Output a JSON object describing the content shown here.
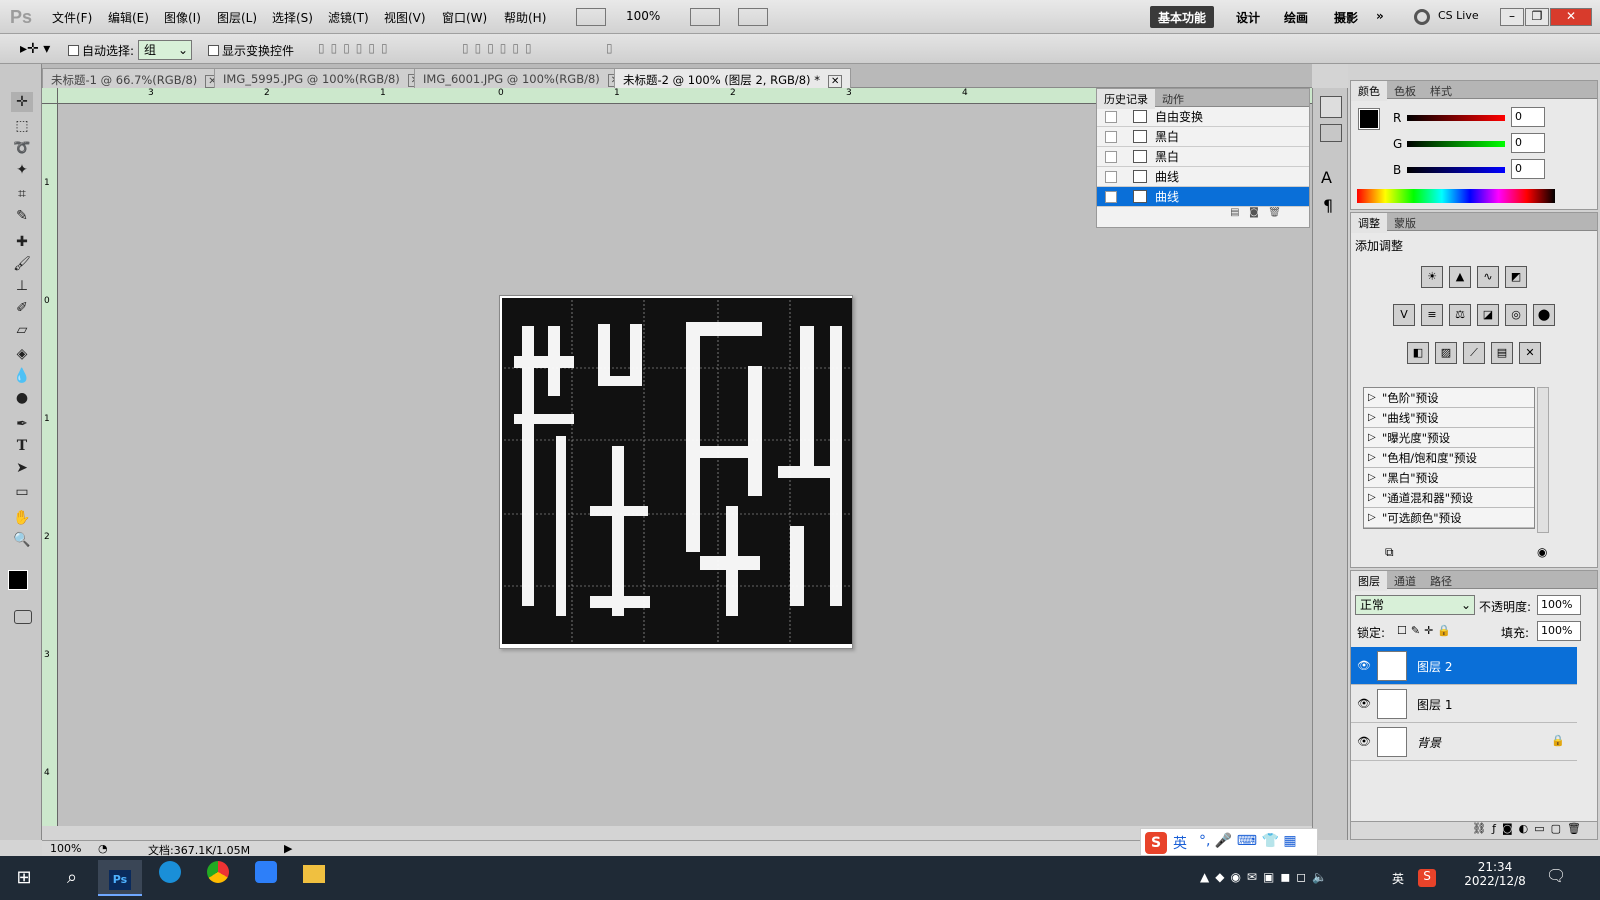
{
  "menubar": {
    "logo": "Ps",
    "items": [
      "文件(F)",
      "编辑(E)",
      "图像(I)",
      "图层(L)",
      "选择(S)",
      "滤镜(T)",
      "视图(V)",
      "窗口(W)",
      "帮助(H)"
    ],
    "zoom": "100%",
    "workspaces": [
      "基本功能",
      "设计",
      "绘画",
      "摄影"
    ],
    "active_workspace": "基本功能",
    "more": "»",
    "cs_live": "CS Live"
  },
  "options": {
    "auto_select_label": "自动选择:",
    "auto_select_value": "组",
    "show_transform_label": "显示变换控件"
  },
  "tabs": [
    {
      "label": "未标题-1 @ 66.7%(RGB/8)"
    },
    {
      "label": "IMG_5995.JPG @ 100%(RGB/8)"
    },
    {
      "label": "IMG_6001.JPG @ 100%(RGB/8)"
    },
    {
      "label": "未标题-2 @ 100% (图层 2, RGB/8) *"
    }
  ],
  "ruler_top": [
    "3",
    "2",
    "1",
    "0",
    "1",
    "2",
    "3",
    "4"
  ],
  "ruler_left": [
    "1",
    "0",
    "1",
    "2",
    "3",
    "4"
  ],
  "status": {
    "zoom": "100%",
    "doc": "文档:367.1K/1.05M"
  },
  "history": {
    "tabs": [
      "历史记录",
      "动作"
    ],
    "rows": [
      "自由变换",
      "黑白",
      "黑白",
      "曲线",
      "曲线"
    ]
  },
  "color_panel": {
    "tabs": [
      "颜色",
      "色板",
      "样式"
    ],
    "r_label": "R",
    "g_label": "G",
    "b_label": "B",
    "r": "0",
    "g": "0",
    "b": "0"
  },
  "adjust_panel": {
    "tabs": [
      "调整",
      "蒙版"
    ],
    "title": "添加调整",
    "presets": [
      "\"色阶\"预设",
      "\"曲线\"预设",
      "\"曝光度\"预设",
      "\"色相/饱和度\"预设",
      "\"黑白\"预设",
      "\"通道混和器\"预设",
      "\"可选颜色\"预设"
    ]
  },
  "layers_panel": {
    "tabs": [
      "图层",
      "通道",
      "路径"
    ],
    "blend": "正常",
    "opacity_label": "不透明度:",
    "opacity": "100%",
    "lock_label": "锁定:",
    "fill_label": "填充:",
    "fill": "100%",
    "layers": [
      "图层 2",
      "图层 1",
      "背景"
    ]
  },
  "taskbar": {
    "time": "21:34",
    "date": "2022/12/8",
    "lang": "英"
  },
  "ime": {
    "label": "英"
  },
  "colors": {
    "selection_blue": "#0a6fd8"
  }
}
